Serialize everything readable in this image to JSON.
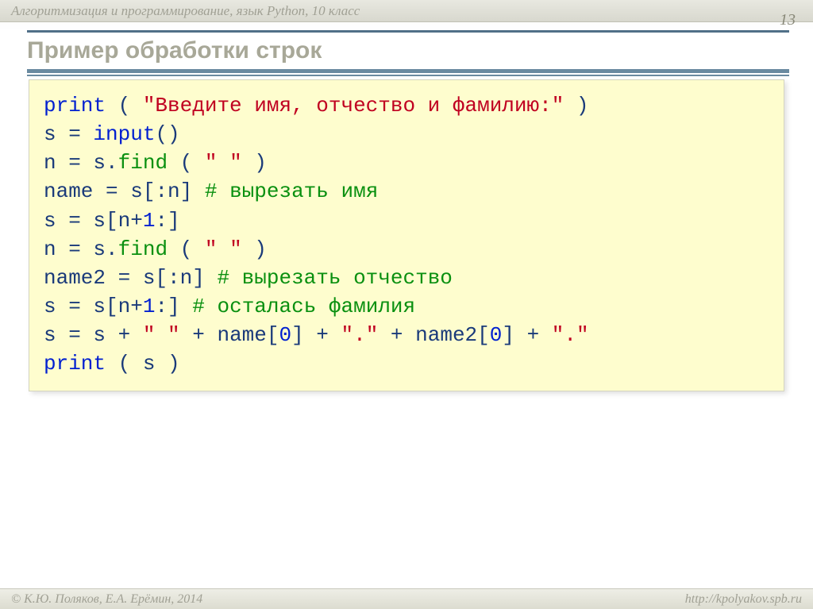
{
  "header": "Алгоритмизация и программирование, язык Python, 10 класс",
  "page_number": "13",
  "title": "Пример обработки строк",
  "code": {
    "l1": {
      "print": "print",
      "lp": " ( ",
      "str": "\"Введите имя, отчество и фамилию:\"",
      "rp": " )"
    },
    "l2": {
      "s": "s",
      "eq": " = ",
      "input": "input",
      "par": "()"
    },
    "l3": {
      "n": "n",
      "eq": " = ",
      "s": "s.",
      "find": "find",
      "arg": " ( ",
      "str": "\" \"",
      "rp": " )"
    },
    "l4": {
      "a": "name",
      "eq": " = ",
      "b": "s[:n]",
      "sp": "    ",
      "c": "# вырезать имя"
    },
    "l5": {
      "a": "s",
      "eq": " = ",
      "b": "s[n+",
      "one": "1",
      "c": ":]"
    },
    "l6": {
      "n": "n",
      "eq": " = ",
      "s": "s.",
      "find": "find",
      "arg": " ( ",
      "str": "\" \"",
      "rp": " )"
    },
    "l7": {
      "a": "name2",
      "eq": " = ",
      "b": "s[:n]",
      "sp": "       ",
      "c": "# вырезать отчество"
    },
    "l8": {
      "a": "s",
      "eq": " = ",
      "b": "s[n+",
      "one": "1",
      "c": ":]",
      "sp": "          ",
      "d": "# осталась фамилия"
    },
    "l9": {
      "a": "s",
      "eq": " = ",
      "b": "s",
      "plus1": " + ",
      "s1": "\" \"",
      "plus2": " + ",
      "c": "name[",
      "z1": "0",
      "d": "]",
      "plus3": " + ",
      "s2": "\".\"",
      "plus4": " + ",
      "e": "name2[",
      "z2": "0",
      "f": "]",
      "plus5": " + ",
      "s3": "\".\""
    },
    "l10": {
      "print": "print",
      "arg": " ( s )"
    }
  },
  "footer": {
    "left": "© К.Ю. Поляков, Е.А. Ерёмин, 2014",
    "right": "http://kpolyakov.spb.ru"
  }
}
